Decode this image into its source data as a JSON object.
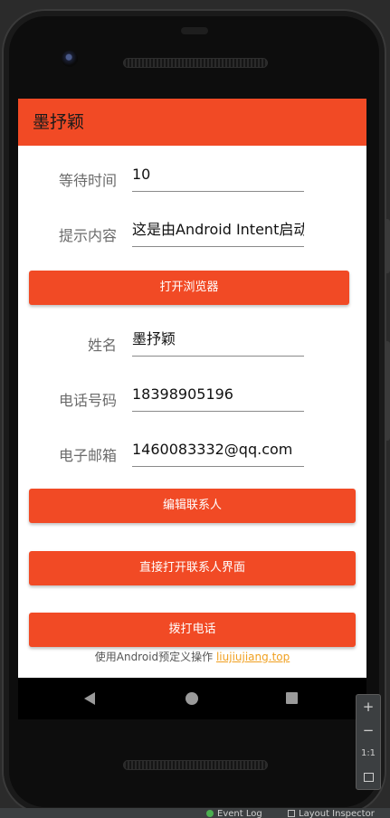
{
  "app": {
    "title": "墨抒颖"
  },
  "form": {
    "wait_time": {
      "label": "等待时间",
      "value": "10"
    },
    "prompt": {
      "label": "提示内容",
      "value": "这是由Android Intent启动"
    },
    "name": {
      "label": "姓名",
      "value": "墨抒颖"
    },
    "phone": {
      "label": "电话号码",
      "value": "18398905196"
    },
    "email": {
      "label": "电子邮箱",
      "value": "1460083332@qq.com"
    }
  },
  "buttons": {
    "open_browser": "打开浏览器",
    "edit_contact": "编辑联系人",
    "open_contacts": "直接打开联系人界面",
    "dial": "拨打电话"
  },
  "footer": {
    "text": "使用Android预定义操作 ",
    "link": "liujiujiang.top"
  },
  "zoom_panel": {
    "zoom_in": "+",
    "zoom_out": "−",
    "actual_size": "1:1"
  },
  "status_bar": {
    "event_log": "Event Log",
    "layout_inspector": "Layout Inspector"
  },
  "colors": {
    "accent": "#f14a25",
    "link": "#f0a020"
  }
}
